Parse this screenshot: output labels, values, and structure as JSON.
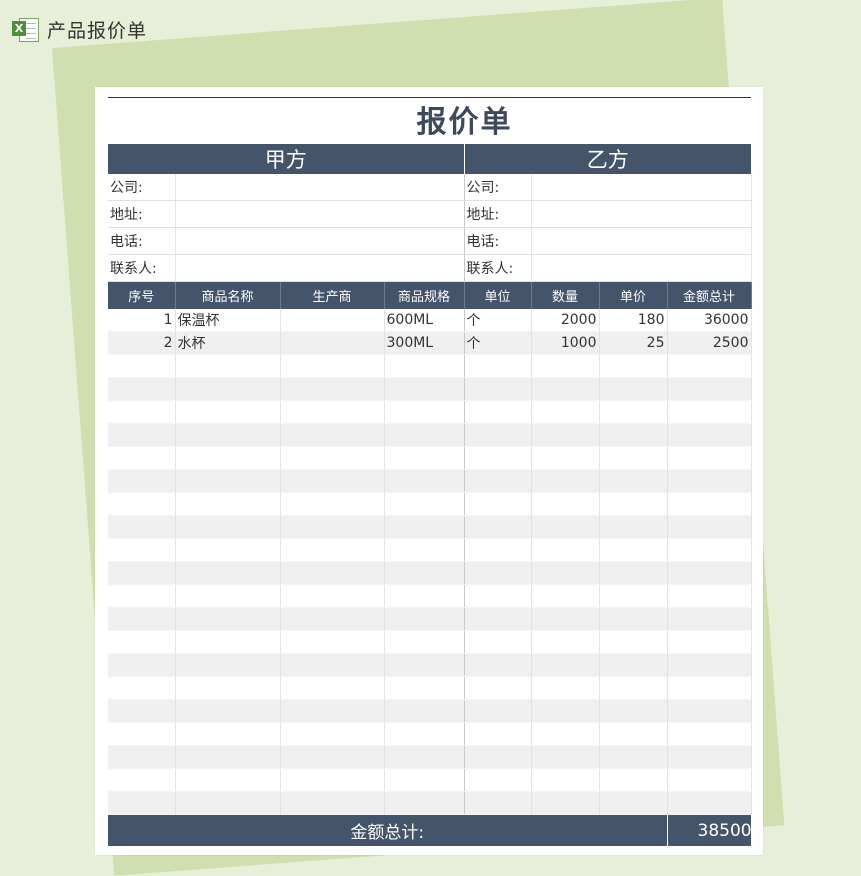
{
  "app": {
    "title": "产品报价单",
    "icon": "excel-icon"
  },
  "doc": {
    "title": "报价单"
  },
  "parties": {
    "left": "甲方",
    "right": "乙方"
  },
  "info_labels": [
    "公司:",
    "地址:",
    "电话:",
    "联系人:"
  ],
  "columns": [
    "序号",
    "商品名称",
    "生产商",
    "商品规格",
    "单位",
    "数量",
    "单价",
    "金额总计"
  ],
  "rows": [
    {
      "no": "1",
      "name": "保温杯",
      "maker": "",
      "spec": "600ML",
      "unit": "个",
      "qty": "2000",
      "price": "180",
      "amount": "36000"
    },
    {
      "no": "2",
      "name": "水杯",
      "maker": "",
      "spec": "300ML",
      "unit": "个",
      "qty": "1000",
      "price": "25",
      "amount": "2500"
    }
  ],
  "empty_rows": 20,
  "total": {
    "label": "金额总计:",
    "value": "38500"
  },
  "colors": {
    "header_bg": "#44546a",
    "background": "#e8efd8",
    "back_sheet": "#cfdfaf"
  }
}
